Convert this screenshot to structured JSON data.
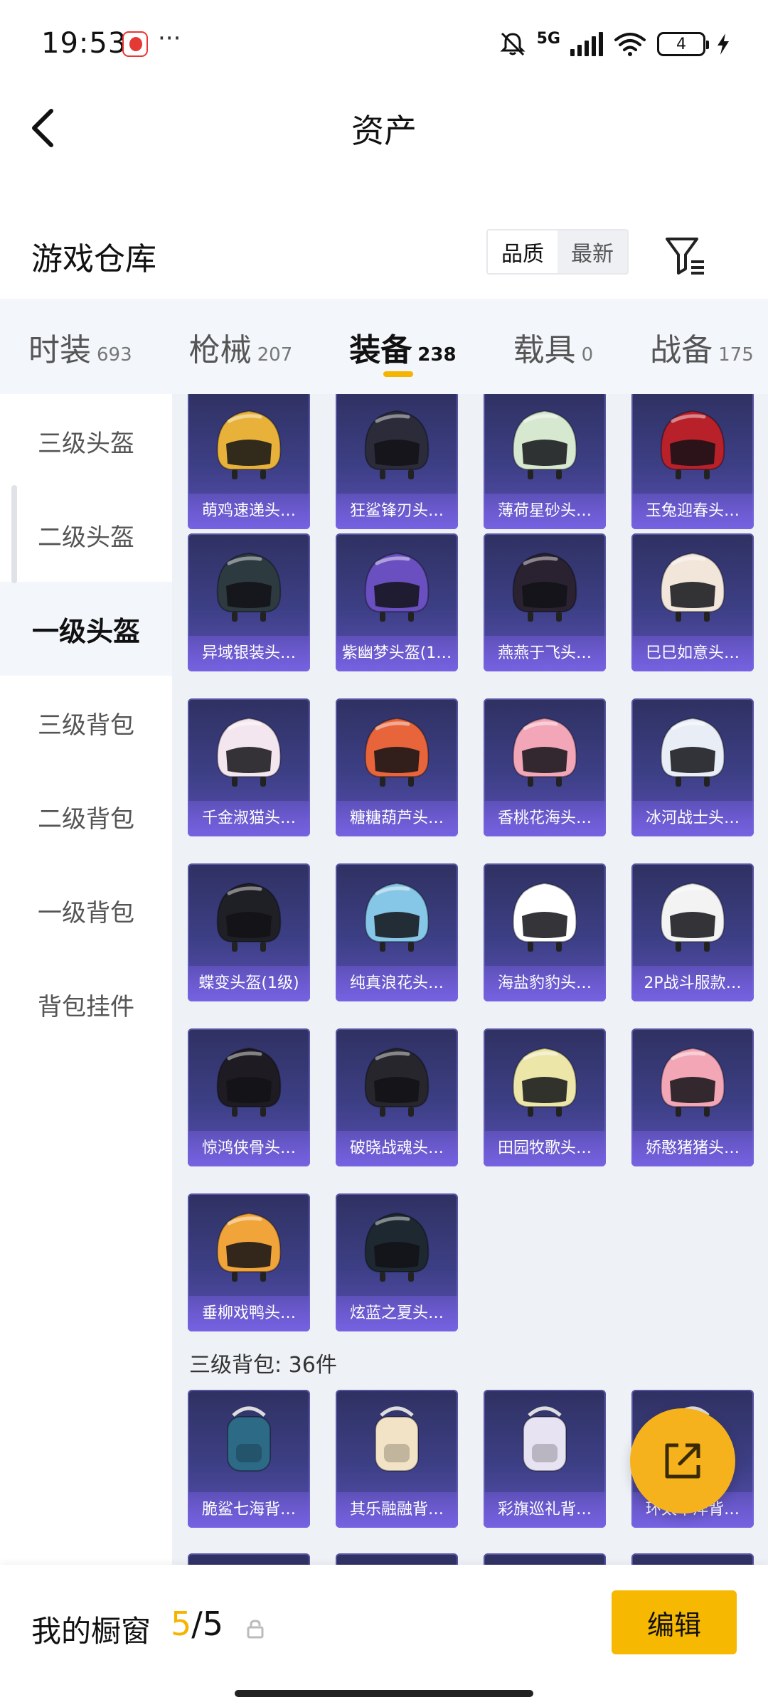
{
  "status": {
    "time": "19:53",
    "more": "···",
    "network": "5G",
    "battery": "4"
  },
  "header": {
    "title": "资产"
  },
  "warehouse": {
    "title": "游戏仓库",
    "sort_options": [
      "品质",
      "最新"
    ]
  },
  "category_tabs": [
    {
      "label": "时装",
      "count": "693"
    },
    {
      "label": "枪械",
      "count": "207"
    },
    {
      "label": "装备",
      "count": "238"
    },
    {
      "label": "载具",
      "count": "0"
    },
    {
      "label": "战备",
      "count": "175"
    }
  ],
  "sidebar": {
    "items": [
      "三级头盔",
      "二级头盔",
      "一级头盔",
      "三级背包",
      "二级背包",
      "一级背包",
      "背包挂件"
    ]
  },
  "helmet_rows": [
    [
      "萌鸡速递头…",
      "狂鲨锋刃头…",
      "薄荷星砂头…",
      "玉兔迎春头…"
    ],
    [
      "异域银装头…",
      "紫幽梦头盔(1…",
      "燕燕于飞头…",
      "巳巳如意头…"
    ],
    [
      "千金淑猫头…",
      "糖糖葫芦头…",
      "香桃花海头…",
      "冰河战士头…"
    ],
    [
      "蝶变头盔(1级)",
      "纯真浪花头…",
      "海盐豹豹头…",
      "2P战斗服款…"
    ],
    [
      "惊鸿侠骨头…",
      "破晓战魂头…",
      "田园牧歌头…",
      "娇憨猪猪头…"
    ],
    [
      "垂柳戏鸭头…",
      "炫蓝之夏头…"
    ]
  ],
  "helmet_colors": [
    [
      "#e8b23a",
      "#2b2b3a",
      "#d7e8d0",
      "#b8202a"
    ],
    [
      "#2d3a40",
      "#6a4fc0",
      "#2a2230",
      "#f2e6da"
    ],
    [
      "#f4e6ee",
      "#e8643a",
      "#f2a6b8",
      "#e9eef6"
    ],
    [
      "#1f1f26",
      "#86c6e6",
      "#ffffff",
      "#f3f3f3"
    ],
    [
      "#1e1c22",
      "#26262c",
      "#ece6a8",
      "#f2a6b6"
    ],
    [
      "#f0a43a",
      "#1d2830"
    ]
  ],
  "backpack_section": {
    "title": "三级背包: 36件",
    "items": [
      "脆鲨七海背…",
      "其乐融融背…",
      "彩旗巡礼背…",
      "环太平洋背…"
    ]
  },
  "showcase": {
    "label": "我的橱窗",
    "current": "5",
    "separator": "/",
    "total": "5",
    "edit_label": "编辑"
  },
  "theme": {
    "accent": "#f5b400",
    "card_bg": "#3d3f86"
  }
}
